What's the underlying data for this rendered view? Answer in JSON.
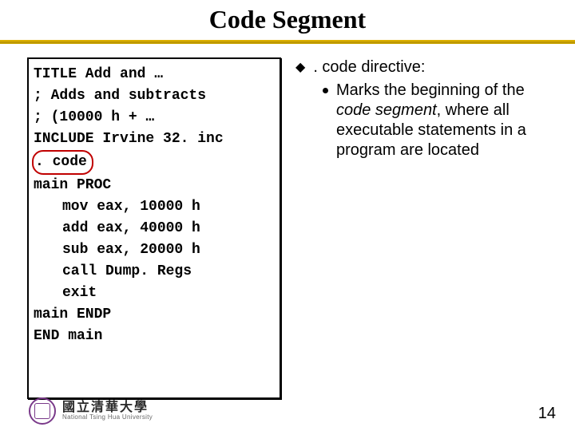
{
  "title": "Code Segment",
  "code": {
    "l1": "TITLE Add and …",
    "l2": "; Adds and subtracts",
    "l3": "; (10000 h + …",
    "l4": "INCLUDE Irvine 32. inc",
    "l5": ". code",
    "l6": "main PROC",
    "l7": "mov eax, 10000 h",
    "l8": "add eax, 40000 h",
    "l9": "sub eax, 20000 h",
    "l10": "call Dump. Regs",
    "l11": "exit",
    "l12": "main ENDP",
    "l13": "END main"
  },
  "notes": {
    "heading": ". code directive:",
    "sub_pre": "Marks the beginning of the ",
    "sub_em": "code segment",
    "sub_post": ", where all executable statements in a program are located"
  },
  "footer": {
    "uni_cn": "國立清華大學",
    "uni_en": "National Tsing Hua University"
  },
  "page_number": "14"
}
